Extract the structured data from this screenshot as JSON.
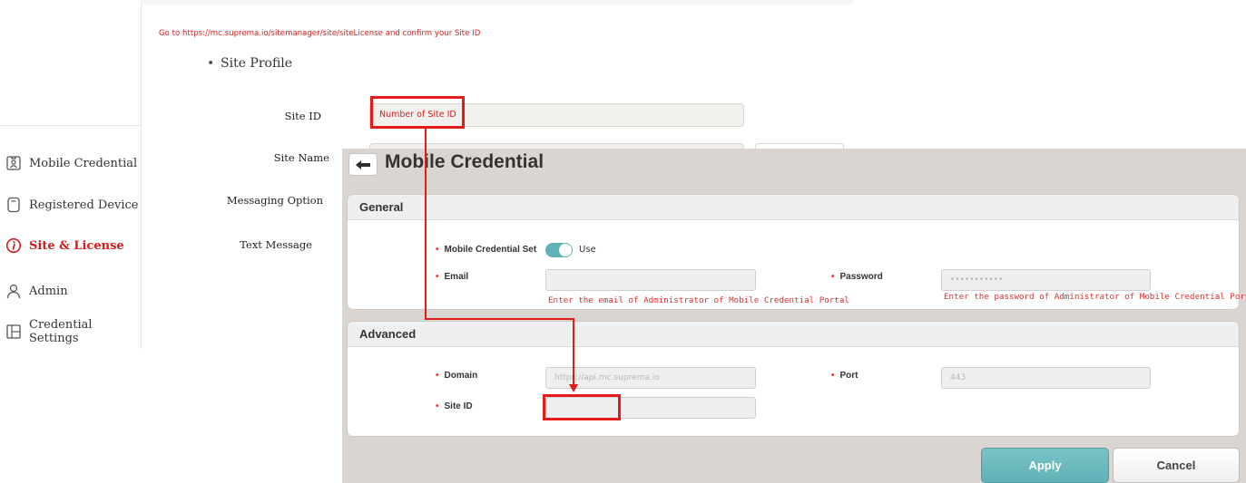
{
  "sidebar": {
    "items": [
      {
        "label": "Mobile Credential",
        "icon": "id-badge-icon"
      },
      {
        "label": "Registered Device",
        "icon": "phone-icon"
      },
      {
        "label": "Site & License",
        "icon": "info-icon"
      },
      {
        "label": "Admin",
        "icon": "person-icon"
      },
      {
        "label": "Credential Settings",
        "icon": "layout-icon"
      }
    ],
    "active_color": "#d61a1a"
  },
  "site_profile": {
    "notice": "Go to https://mc.suprema.io/sitemanager/site/siteLicense  and confirm your Site ID",
    "section_title": "Site Profile",
    "labels": {
      "site_id": "Site ID",
      "site_name": "Site Name",
      "messaging_option": "Messaging Option",
      "text_message": "Text Message"
    },
    "site_id_value": "Number of Site ID"
  },
  "panel": {
    "title": "Mobile Credential",
    "general": {
      "heading": "General",
      "mobile_credential_set_label": "Mobile Credential Set",
      "toggle_label": "Use",
      "toggle_on": true,
      "email_label": "Email",
      "email_value": "",
      "email_hint": "Enter the email of Administrator of Mobile Credential Portal",
      "password_label": "Password",
      "password_value": "•••••••••••",
      "password_hint": "Enter the password of Administrator of Mobile Credential Portal"
    },
    "advanced": {
      "heading": "Advanced",
      "domain_label": "Domain",
      "domain_value": "https://api.mc.suprema.io",
      "port_label": "Port",
      "port_value": "443",
      "site_id_label": "Site ID",
      "site_id_value": ""
    },
    "buttons": {
      "apply": "Apply",
      "cancel": "Cancel"
    }
  },
  "colors": {
    "accent": "#5fb3b7",
    "highlight": "#e21b1b",
    "panel_bg": "#dad5d0",
    "hint_text": "#d63232"
  }
}
